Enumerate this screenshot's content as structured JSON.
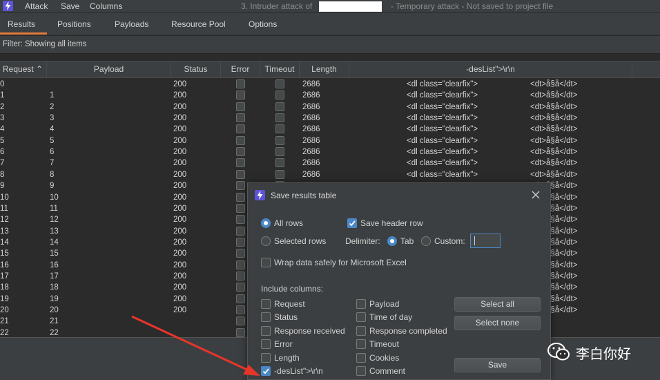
{
  "menu": {
    "attack": "Attack",
    "save": "Save",
    "columns": "Columns"
  },
  "window": {
    "title_prefix": "3. Intruder attack of",
    "title_suffix": "- Temporary attack - Not saved to project file"
  },
  "tabs": [
    "Results",
    "Positions",
    "Payloads",
    "Resource Pool",
    "Options"
  ],
  "filter": "Filter: Showing all items",
  "columns": {
    "request": "Request",
    "payload": "Payload",
    "status": "Status",
    "error": "Error",
    "timeout": "Timeout",
    "length": "Length",
    "grep": "-desList\">\\r\\n"
  },
  "cell_grep_a": "<dl class=\"clearfix\">",
  "cell_grep_b": "<dt>å§å</dt>",
  "rows": [
    {
      "request": "0",
      "payload": "",
      "status": "200",
      "length": "2686",
      "grep_a": true,
      "grep_b": true
    },
    {
      "request": "1",
      "payload": "1",
      "status": "200",
      "length": "2686",
      "grep_a": true,
      "grep_b": true
    },
    {
      "request": "2",
      "payload": "2",
      "status": "200",
      "length": "2686",
      "grep_a": true,
      "grep_b": true
    },
    {
      "request": "3",
      "payload": "3",
      "status": "200",
      "length": "2686",
      "grep_a": true,
      "grep_b": true
    },
    {
      "request": "4",
      "payload": "4",
      "status": "200",
      "length": "2686",
      "grep_a": true,
      "grep_b": true
    },
    {
      "request": "5",
      "payload": "5",
      "status": "200",
      "length": "2686",
      "grep_a": true,
      "grep_b": true
    },
    {
      "request": "6",
      "payload": "6",
      "status": "200",
      "length": "2686",
      "grep_a": true,
      "grep_b": true
    },
    {
      "request": "7",
      "payload": "7",
      "status": "200",
      "length": "2686",
      "grep_a": true,
      "grep_b": true
    },
    {
      "request": "8",
      "payload": "8",
      "status": "200",
      "length": "2686",
      "grep_a": true,
      "grep_b": true
    },
    {
      "request": "9",
      "payload": "9",
      "status": "200",
      "length": "",
      "grep_a": false,
      "grep_b": true
    },
    {
      "request": "10",
      "payload": "10",
      "status": "200",
      "length": "",
      "grep_a": false,
      "grep_b": true
    },
    {
      "request": "11",
      "payload": "11",
      "status": "200",
      "length": "",
      "grep_a": false,
      "grep_b": true
    },
    {
      "request": "12",
      "payload": "12",
      "status": "200",
      "length": "",
      "grep_a": false,
      "grep_b": true
    },
    {
      "request": "13",
      "payload": "13",
      "status": "200",
      "length": "",
      "grep_a": false,
      "grep_b": true
    },
    {
      "request": "14",
      "payload": "14",
      "status": "200",
      "length": "",
      "grep_a": false,
      "grep_b": true
    },
    {
      "request": "15",
      "payload": "15",
      "status": "200",
      "length": "",
      "grep_a": false,
      "grep_b": true
    },
    {
      "request": "16",
      "payload": "16",
      "status": "200",
      "length": "",
      "grep_a": false,
      "grep_b": true
    },
    {
      "request": "17",
      "payload": "17",
      "status": "200",
      "length": "",
      "grep_a": false,
      "grep_b": true
    },
    {
      "request": "18",
      "payload": "18",
      "status": "200",
      "length": "",
      "grep_a": false,
      "grep_b": true
    },
    {
      "request": "19",
      "payload": "19",
      "status": "200",
      "length": "",
      "grep_a": false,
      "grep_b": true
    },
    {
      "request": "20",
      "payload": "20",
      "status": "200",
      "length": "",
      "grep_a": false,
      "grep_b": true
    },
    {
      "request": "21",
      "payload": "21",
      "status": "",
      "length": "",
      "grep_a": false,
      "grep_b": false
    },
    {
      "request": "22",
      "payload": "22",
      "status": "",
      "length": "",
      "grep_a": false,
      "grep_b": false
    }
  ],
  "dialog": {
    "title": "Save results table",
    "all_rows": "All rows",
    "selected_rows": "Selected rows",
    "save_header_row": "Save header row",
    "delimiter": "Delimiter:",
    "tab": "Tab",
    "custom": "Custom:",
    "wrap": "Wrap data safely for Microsoft Excel",
    "include_columns": "Include columns:",
    "col_request": "Request",
    "col_status": "Status",
    "col_response_received": "Response received",
    "col_error": "Error",
    "col_length": "Length",
    "col_grep": "-desList\">\\r\\n",
    "col_payload": "Payload",
    "col_time_of_day": "Time of day",
    "col_response_completed": "Response completed",
    "col_timeout": "Timeout",
    "col_cookies": "Cookies",
    "col_comment": "Comment",
    "select_all": "Select all",
    "select_none": "Select none",
    "save": "Save"
  },
  "watermark": "李白你好",
  "colors": {
    "accent": "#e27b3e",
    "logo": "#5d54d6",
    "selected": "#4a88c7",
    "arrow": "#e8352a"
  }
}
